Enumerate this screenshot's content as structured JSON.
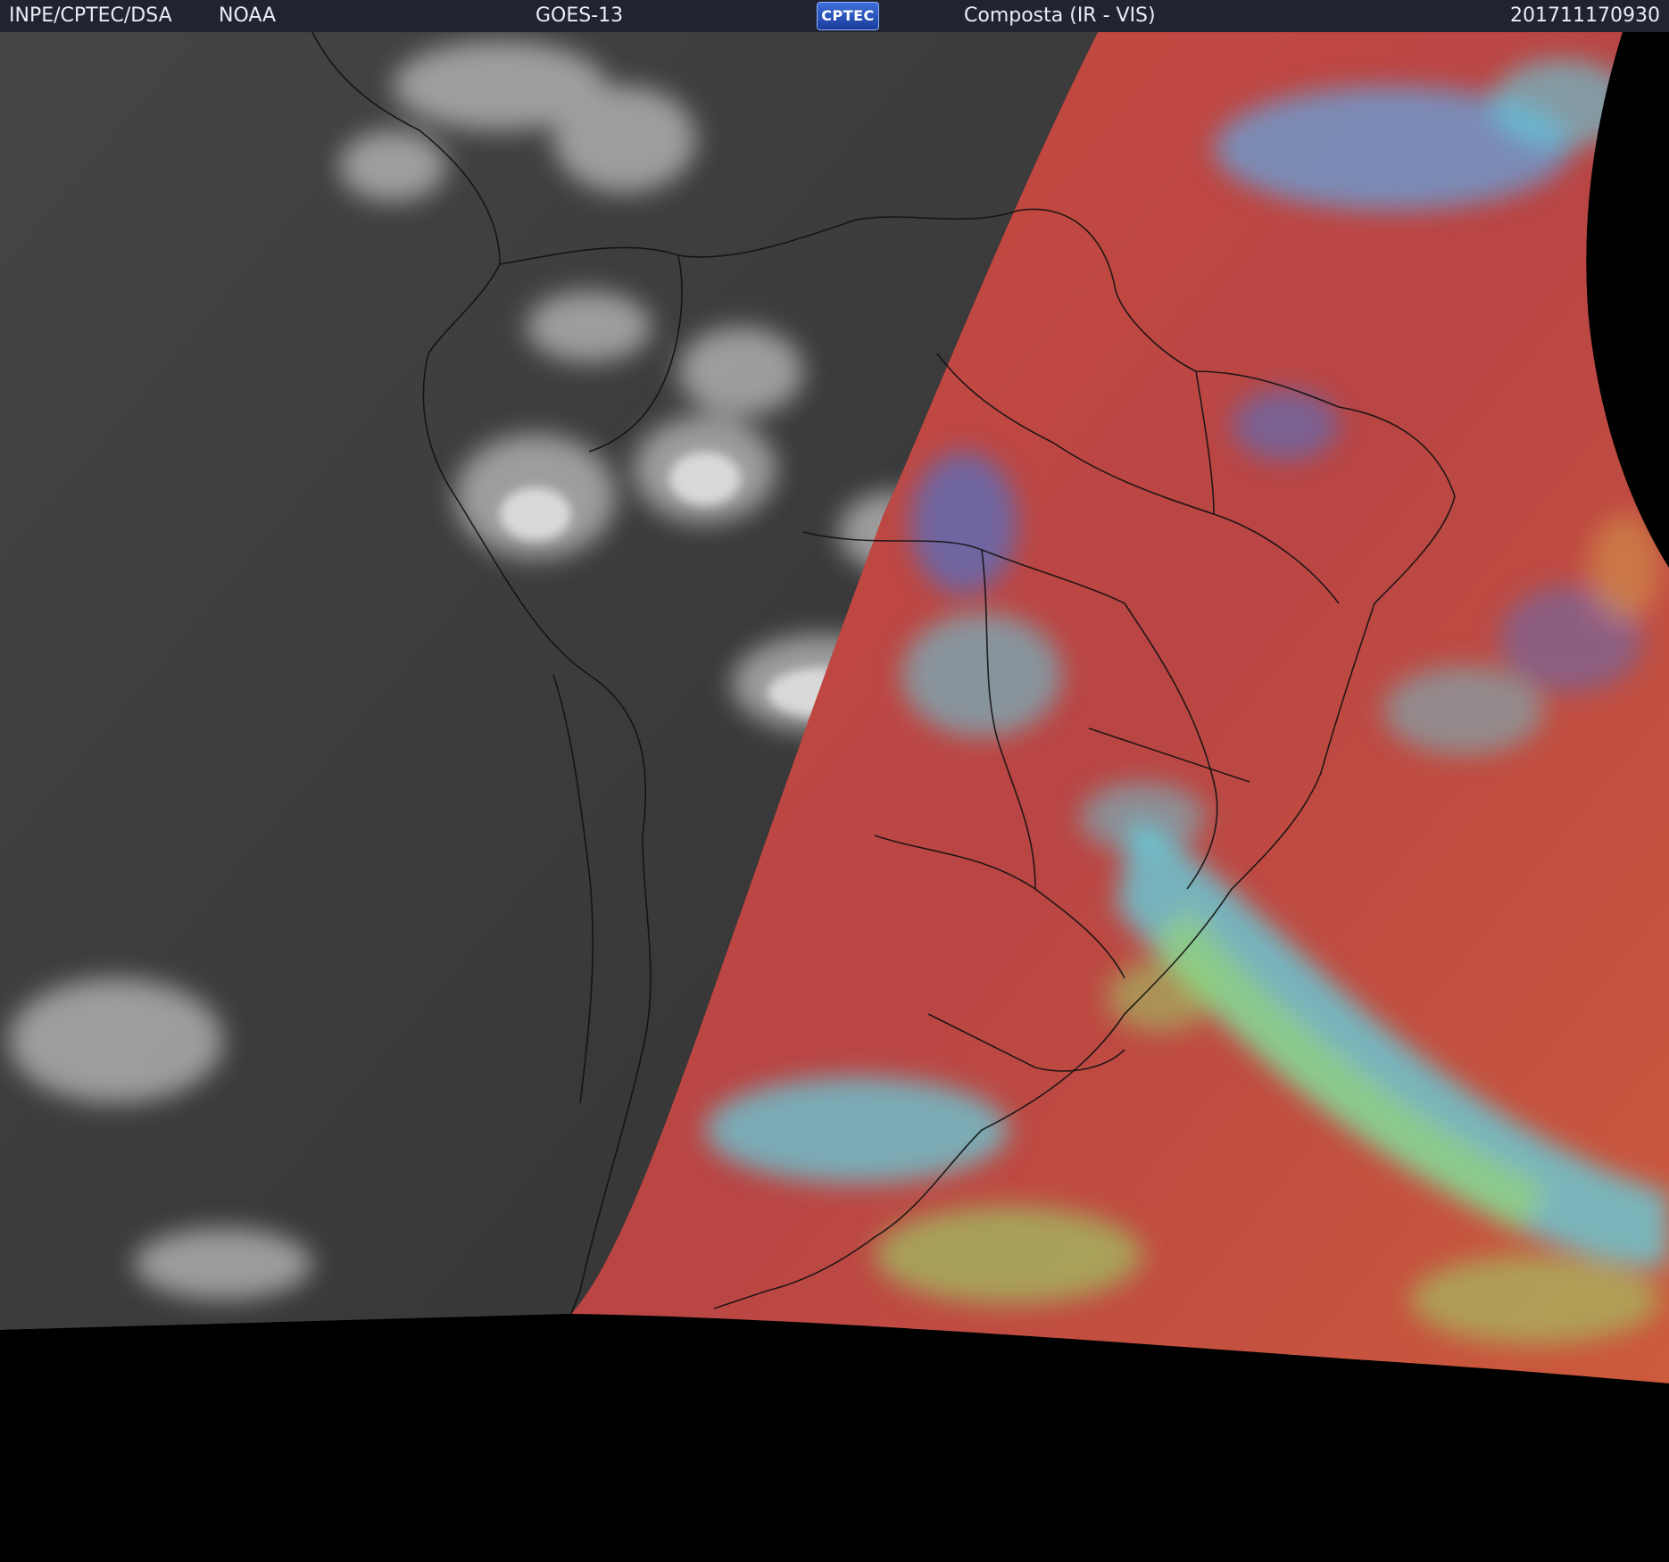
{
  "header": {
    "organization": "INPE/CPTEC/DSA",
    "agency": "NOAA",
    "satellite": "GOES-13",
    "logo_text": "CPTEC",
    "product": "Composta (IR - VIS)",
    "timestamp": "201711170930"
  },
  "imagery": {
    "ir_side_color": "#3c3c3c",
    "vis_side_color": "#c04a3a",
    "cloud_cyan": "#5fd6e6",
    "cloud_green": "#9ad96a",
    "cloud_blue": "#3b7be0",
    "no_data_color": "#000000",
    "map_outline_color": "#111111"
  }
}
